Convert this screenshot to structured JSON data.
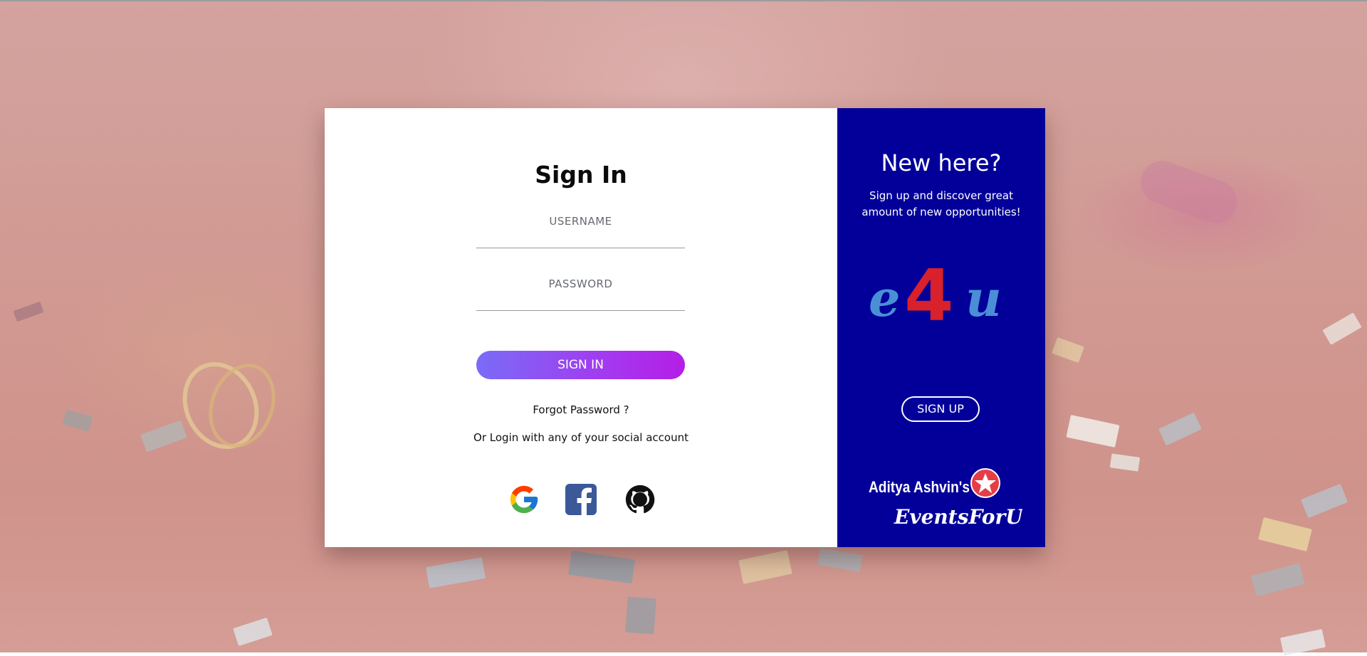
{
  "signin": {
    "title": "Sign In",
    "username_label": "USERNAME",
    "password_label": "PASSWORD",
    "button_label": "SIGN IN",
    "forgot_label": "Forgot Password ?",
    "social_text": "Or Login with any of your social account"
  },
  "social": {
    "icons": [
      "google-icon",
      "facebook-icon",
      "github-icon"
    ]
  },
  "signup_panel": {
    "heading": "New here?",
    "description": "Sign up and discover great amount of new opportunities!",
    "logo_text": "e4u",
    "button_label": "SIGN UP",
    "brand_line1": "Aditya Ashvin's",
    "brand_line2": "EventsForU"
  },
  "colors": {
    "panel_bg": "#03009a",
    "gradient_start": "#7a6cf7",
    "gradient_end": "#b41ee6",
    "logo_e_u": "#4a8fd6",
    "logo_4": "#d8212a",
    "badge_red": "#e53d46"
  }
}
